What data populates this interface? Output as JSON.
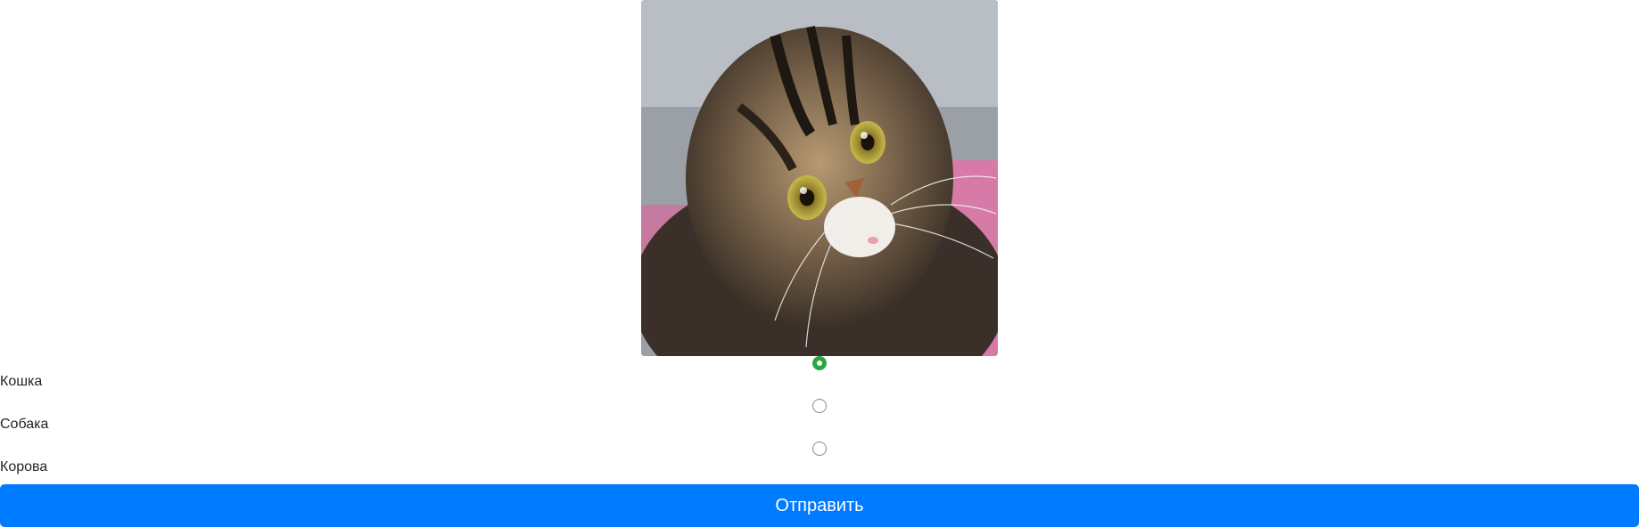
{
  "quiz": {
    "options": [
      {
        "label": "Кошка",
        "checked": true
      },
      {
        "label": "Собака",
        "checked": false
      },
      {
        "label": "Корова",
        "checked": false
      }
    ],
    "submit_label": "Отправить"
  },
  "colors": {
    "accent": "#007bff",
    "selected": "#28a745",
    "text": "#212529"
  }
}
